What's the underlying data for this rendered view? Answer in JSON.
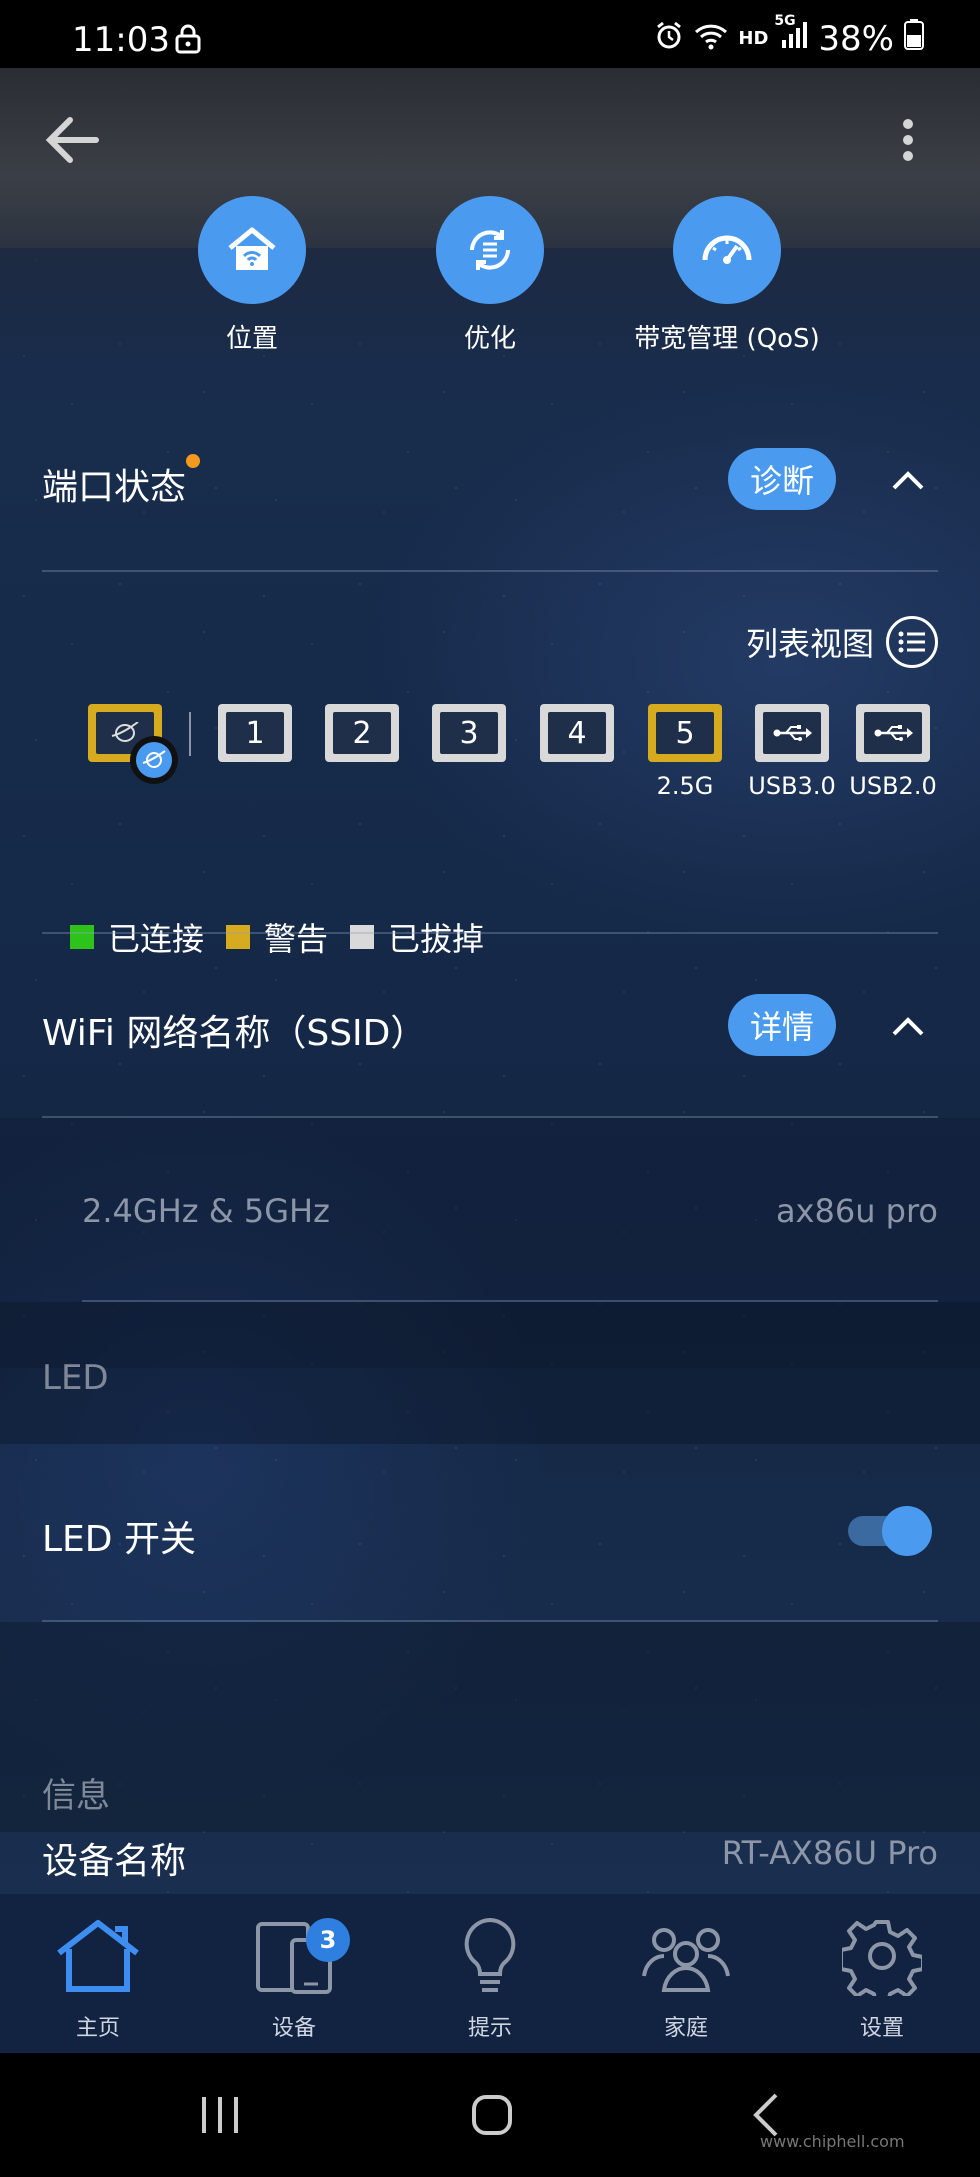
{
  "status_bar": {
    "time": "11:03",
    "network_hd": "HD",
    "network_5g": "5G",
    "battery": "38%"
  },
  "quick_actions": [
    {
      "label": "位置",
      "icon": "home-wifi-icon"
    },
    {
      "label": "优化",
      "icon": "optimize-icon"
    },
    {
      "label": "带宽管理 (QoS)",
      "icon": "speedometer-icon"
    }
  ],
  "port_status": {
    "title": "端口状态",
    "diagnose_label": "诊断",
    "list_view_label": "列表视图",
    "ports": [
      {
        "label": "",
        "state": "warning",
        "type": "wan"
      },
      {
        "label": "1",
        "state": "unplugged",
        "type": "lan"
      },
      {
        "label": "2",
        "state": "unplugged",
        "type": "lan"
      },
      {
        "label": "3",
        "state": "unplugged",
        "type": "lan"
      },
      {
        "label": "4",
        "state": "unplugged",
        "type": "lan"
      },
      {
        "label": "5",
        "state": "warning",
        "type": "lan",
        "caption": "2.5G"
      },
      {
        "label": "",
        "state": "unplugged",
        "type": "usb",
        "caption": "USB3.0"
      },
      {
        "label": "",
        "state": "unplugged",
        "type": "usb",
        "caption": "USB2.0"
      }
    ],
    "legend": {
      "connected": "已连接",
      "warning": "警告",
      "unplugged": "已拔掉"
    },
    "colors": {
      "connected": "#2ec31b",
      "warning": "#d6ab1f",
      "unplugged": "#d9d9d9"
    }
  },
  "wifi": {
    "title": "WiFi 网络名称（SSID）",
    "details_label": "详情",
    "band": "2.4GHz & 5GHz",
    "ssid": "ax86u pro"
  },
  "led": {
    "section": "LED",
    "switch_label": "LED 开关",
    "enabled": true
  },
  "info": {
    "section": "信息",
    "device_name_label": "设备名称",
    "device_name_value": "RT-AX86U Pro"
  },
  "bottom_nav": [
    {
      "label": "主页",
      "icon": "home-icon",
      "active": true
    },
    {
      "label": "设备",
      "icon": "devices-icon",
      "badge": "3"
    },
    {
      "label": "提示",
      "icon": "lightbulb-icon"
    },
    {
      "label": "家庭",
      "icon": "family-icon"
    },
    {
      "label": "设置",
      "icon": "gear-icon"
    }
  ],
  "watermark": "www.chiphell.com",
  "accent_color": "#4a9bef"
}
